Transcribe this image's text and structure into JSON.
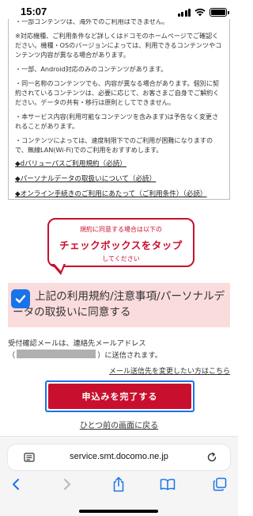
{
  "status_bar": {
    "time": "15:07"
  },
  "terms": {
    "paragraphs": [
      "・一部コンテンツは、海外でのご利用はできません。",
      "※対応機種、ご利用条件など詳しくはドコモのホームページでご確認ください。機種・OSのバージョンによっては、利用できるコンテンツやコンテンツ内容が異なる場合があります。",
      "・一部、Android対応のみのコンテンツがあります。",
      "・同一名称のコンテンツでも、内容が異なる場合があります。個別に契約されているコンテンツは、必要に応じて、お客さまご自身でご解約ください。データの共有・移行は原則としてできません。",
      "・本サービス内容(利用可能なコンテンツを含みます)は予告なく変更されることがあります。",
      "・コンテンツによっては、速度制限下でのご利用が困難になりますので、無線LAN(Wi-Fi)でのご利用をおすすめします。"
    ],
    "links": [
      "◆dバリューパスご利用規約（必読）",
      "◆パーソナルデータの取扱いについて（必読）",
      "◆オンライン手続きのご利用にあたって（ご利用条件）（必読）"
    ]
  },
  "callout": {
    "line1": "規約に同意する場合は以下の",
    "line2": "チェックボックスをタップ",
    "line3": "してください",
    "color": "#c8102e"
  },
  "agree": {
    "label": "上記の利用規約/注意事項/パーソナルデータの取扱いに同意する",
    "checked": true,
    "checkbox_color": "#1a73e8",
    "panel_color": "#fbdcdc"
  },
  "confirmation": {
    "prefix": "受付確認メールは、連絡先メールアドレス",
    "open_paren": "（",
    "suffix": "）に送信されます。"
  },
  "change_email_link": "メール送信先を変更したい方はこちら",
  "submit_button": {
    "label": "申込みを完了する",
    "color": "#c8102e"
  },
  "back_link": "ひとつ前の画面に戻る",
  "browser": {
    "url": "service.smt.docomo.ne.jp",
    "icons": [
      "reader-icon",
      "reload-icon",
      "back-icon",
      "forward-icon",
      "share-icon",
      "bookmarks-icon",
      "tabs-icon"
    ]
  }
}
